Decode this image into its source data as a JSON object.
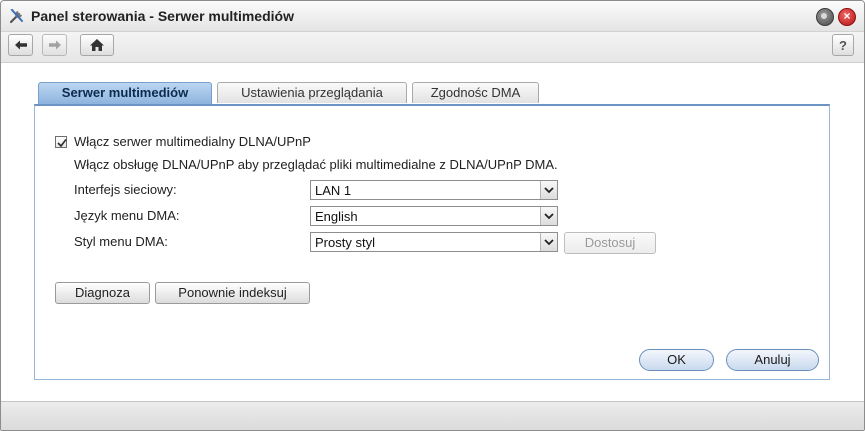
{
  "window": {
    "title": "Panel sterowania - Serwer multimediów",
    "close_glyph": "×"
  },
  "toolbar": {
    "back_icon": "arrow-left-icon",
    "forward_icon": "arrow-right-icon",
    "home_icon": "home-icon",
    "help_label": "?"
  },
  "tabs": [
    {
      "label": "Serwer multimediów",
      "active": true
    },
    {
      "label": "Ustawienia przeglądania",
      "active": false
    },
    {
      "label": "Zgodnośc DMA",
      "active": false
    }
  ],
  "form": {
    "enable_checkbox_label": "Włącz serwer multimedialny DLNA/UPnP",
    "enable_checked": true,
    "description": "Włącz obsługę DLNA/UPnP aby przeglądać pliki multimedialne z DLNA/UPnP DMA.",
    "network_interface_label": "Interfejs sieciowy:",
    "network_interface_value": "LAN 1",
    "dma_language_label": "Język menu DMA:",
    "dma_language_value": "English",
    "dma_style_label": "Styl menu DMA:",
    "dma_style_value": "Prosty styl",
    "customize_label": "Dostosuj"
  },
  "actions": {
    "diagnose_label": "Diagnoza",
    "reindex_label": "Ponownie indeksuj",
    "ok_label": "OK",
    "cancel_label": "Anuluj"
  },
  "colors": {
    "active_tab": "#8db4de",
    "panel_border": "#6b93c4",
    "close_button": "#d32020"
  }
}
